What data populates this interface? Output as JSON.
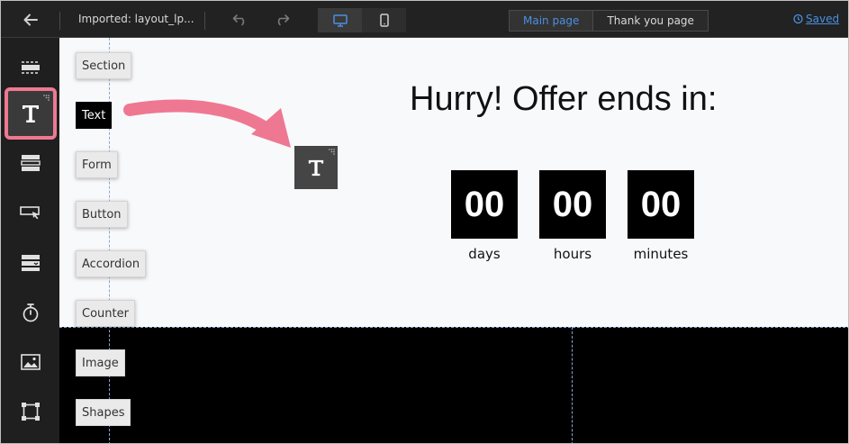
{
  "topbar": {
    "document_title": "Imported: layout_lp...",
    "page_tabs": [
      {
        "label": "Main page"
      },
      {
        "label": "Thank you page"
      }
    ],
    "saved_label": "Saved"
  },
  "palette": [
    {
      "label": "Section"
    },
    {
      "label": "Text"
    },
    {
      "label": "Form"
    },
    {
      "label": "Button"
    },
    {
      "label": "Accordion"
    },
    {
      "label": "Counter"
    },
    {
      "label": "Image"
    },
    {
      "label": "Shapes"
    }
  ],
  "canvas": {
    "headline": "Hurry! Offer ends in:",
    "countdown": [
      {
        "value": "00",
        "label": "days"
      },
      {
        "value": "00",
        "label": "hours"
      },
      {
        "value": "00",
        "label": "minutes"
      }
    ]
  },
  "colors": {
    "accent_blue": "#4a90e2",
    "highlight_pink": "#ee7892",
    "toolbar_bg": "#222222",
    "canvas_bg": "#f8f9fb"
  }
}
